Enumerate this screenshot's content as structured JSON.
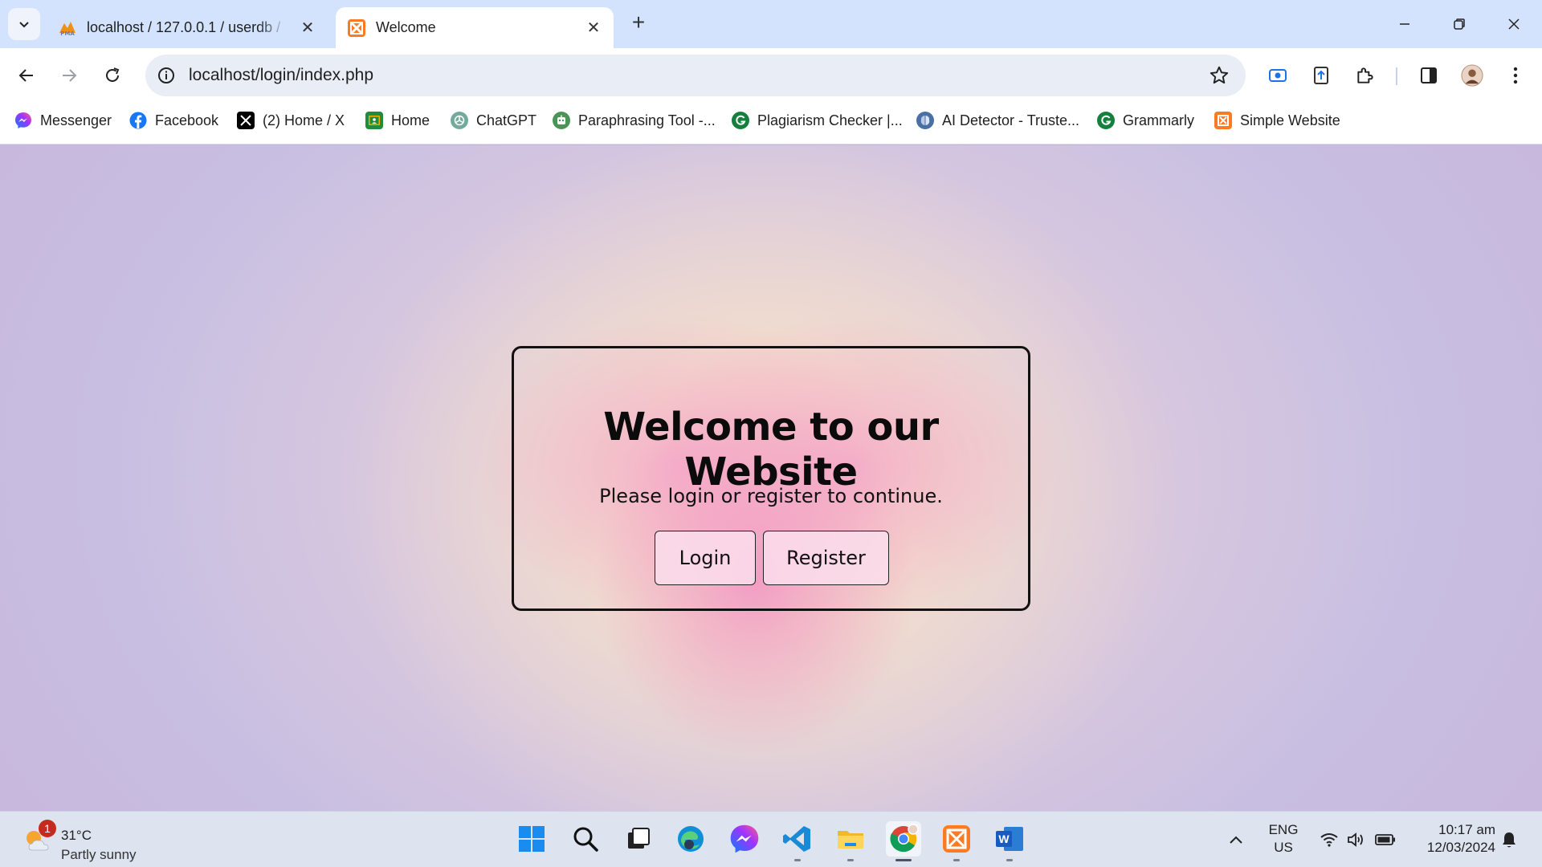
{
  "browser": {
    "tabs": [
      {
        "title": "localhost / 127.0.0.1 / userdb / ",
        "favicon": "phpmyadmin-icon",
        "active": false
      },
      {
        "title": "Welcome",
        "favicon": "xampp-icon",
        "active": true
      }
    ],
    "url": "localhost/login/index.php"
  },
  "bookmarks": [
    {
      "label": "Messenger",
      "icon": "messenger-icon",
      "color": "#8a3ffc"
    },
    {
      "label": "Facebook",
      "icon": "facebook-icon",
      "color": "#1877f2"
    },
    {
      "label": "(2) Home / X",
      "icon": "x-icon",
      "color": "#000000"
    },
    {
      "label": "Home",
      "icon": "classroom-icon",
      "color": "#1e8e3e"
    },
    {
      "label": "ChatGPT",
      "icon": "chatgpt-icon",
      "color": "#74aa9c"
    },
    {
      "label": "Paraphrasing Tool -...",
      "icon": "paraphrasing-icon",
      "color": "#499557"
    },
    {
      "label": "Plagiarism Checker |...",
      "icon": "grammarly-g-icon",
      "color": "#15803d"
    },
    {
      "label": "AI Detector - Truste...",
      "icon": "brain-icon",
      "color": "#4a6fa5"
    },
    {
      "label": "Grammarly",
      "icon": "grammarly-icon",
      "color": "#15803d"
    },
    {
      "label": "Simple Website",
      "icon": "xampp-icon",
      "color": "#fb7a24"
    }
  ],
  "page": {
    "heading": "Welcome to our Website",
    "subtext": "Please login or register to continue.",
    "login_label": "Login",
    "register_label": "Register"
  },
  "taskbar": {
    "weather": {
      "badge": "1",
      "temp": "31°C",
      "condition": "Partly sunny"
    },
    "lang": {
      "line1": "ENG",
      "line2": "US"
    },
    "time": "10:17 am",
    "date": "12/03/2024"
  }
}
